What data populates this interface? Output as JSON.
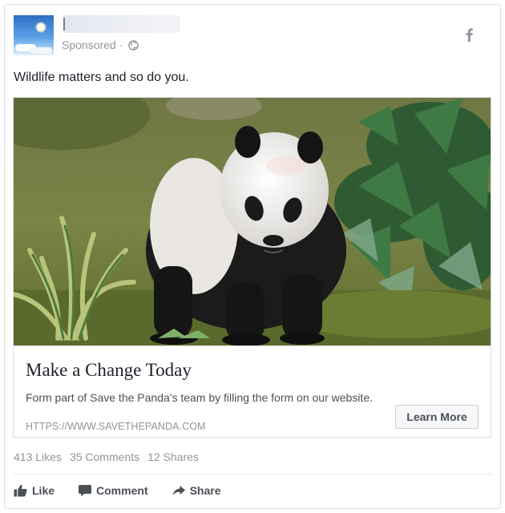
{
  "post": {
    "sponsored_label": "Sponsored",
    "separator": "·",
    "text": "Wildlife matters and so do you."
  },
  "icons": {
    "globe": "globe-icon",
    "facebook": "facebook-icon",
    "like": "thumbs-up-icon",
    "comment": "speech-bubble-icon",
    "share": "share-arrow-icon"
  },
  "attachment": {
    "headline": "Make a Change Today",
    "description": "Form part of Save the Panda's team by filling the form on our website.",
    "url": "HTTPS://WWW.SAVETHEPANDA.COM",
    "cta_label": "Learn More"
  },
  "stats": {
    "likes": "413 Likes",
    "comments": "35 Comments",
    "shares": "12 Shares"
  },
  "actions": {
    "like_label": "Like",
    "comment_label": "Comment",
    "share_label": "Share"
  },
  "colors": {
    "meta_text": "#90949c",
    "button_bg": "#f6f7f9",
    "border": "#dddfe2"
  }
}
